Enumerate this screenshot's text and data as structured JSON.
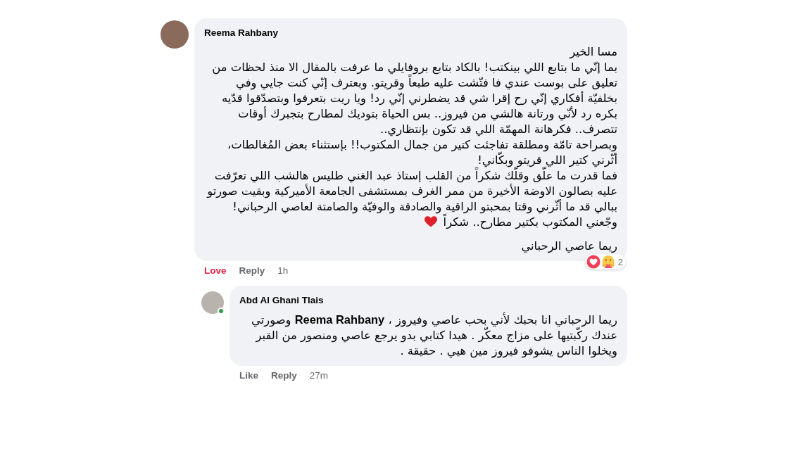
{
  "comments": [
    {
      "author": "Reema Rahbany",
      "paragraphs": [
        "مسا الخير",
        "بما إنّي ما بتابع اللي بينكتب! بالكاد بتابع بروفايلي ما عرفت بالمقال الا منذ لحظات من تعليق على بوست عندي فا فتّشت عليه طبعاً وقريتو. وبعترف إنّي كنت جايي وفي بخلفيّة أفكاري إنّي رح إقرا شي قد يضطرني إنّي رد! ويا ريت بتعرفوا وبتصدّقوا قدّيه بكره رد لأنّي ورتانة هالشي من فيروز.. بس الحياة بتوديك لمطارح بتجبرك أوقات تتصرف.. فكرهانة المهمّة اللي قد تكون بإنتظاري..",
        "وبصراحة تامّة ومطلقة تفاجئت كتير من جمال المكتوب!! بإستثناء بعض المُغالطات، أثّرني كتير اللي قريتو وبكّاني!",
        "فما قدرت ما علّق وقلّك شكراً من القلب إستاذ عبد الغني طليس هالشب اللي تعرّفت عليه بصالون الاوضة الأخيرة من ممر الغرف بمستشفى الجامعة الأميركية وبقيت صورتو ببالي قد ما أثّرني وقتا بمحبتو الراقية والصادقة والوفيّة والصامتة لعاصي الرحباني!",
        "وجّعني المكتوب بكتير مطارح.. شكراً"
      ],
      "heart_after_last": true,
      "signature": "ريما عاصي الرحباني",
      "reaction_link": {
        "label": "Love",
        "selected": true
      },
      "reply_link": "Reply",
      "time": "1h",
      "reactions": {
        "count": "2"
      },
      "online": false,
      "reply": false
    },
    {
      "author": "Abd Al Ghani Tlais",
      "paragraphs": [
        "ريما الرحباني انا بحبك لأني بحب عاصي وفيروز ، **Reema Rahbany** وصورتي عندك ركّبتيها على مزاج معكّر . هيدا كتابي بدو يرجع عاصي ومنصور من القبر ويخلوا الناس يشوفو فيروز مين هيي . حقيقة ."
      ],
      "heart_after_last": false,
      "reaction_link": {
        "label": "Like",
        "selected": false
      },
      "reply_link": "Reply",
      "time": "27m",
      "online": true,
      "reply": true
    }
  ]
}
